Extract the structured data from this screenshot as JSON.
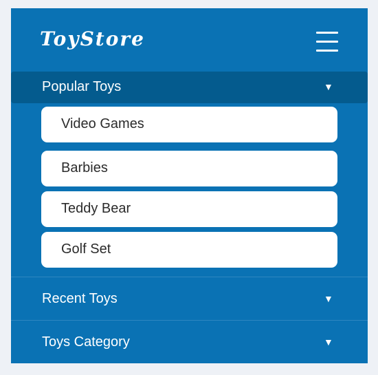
{
  "header": {
    "brand": "ToyStore"
  },
  "menu": {
    "sections": [
      {
        "label": "Popular Toys",
        "caret": "▼",
        "expanded": true,
        "items": [
          "Video Games",
          "Barbies",
          "Teddy Bear",
          "Golf Set"
        ]
      },
      {
        "label": "Recent Toys",
        "caret": "▼",
        "expanded": false
      },
      {
        "label": "Toys Category",
        "caret": "▼",
        "expanded": false
      }
    ]
  },
  "icons": {
    "menu": "hamburger-menu-icon",
    "caret": "caret-down-icon"
  },
  "colors": {
    "panel_background": "#0a72b4",
    "active_section_background": "#045b8e",
    "item_background": "#ffffff",
    "text_light": "#ffffff",
    "text_dark": "#2b2b2b",
    "page_background": "#eef1f6"
  }
}
